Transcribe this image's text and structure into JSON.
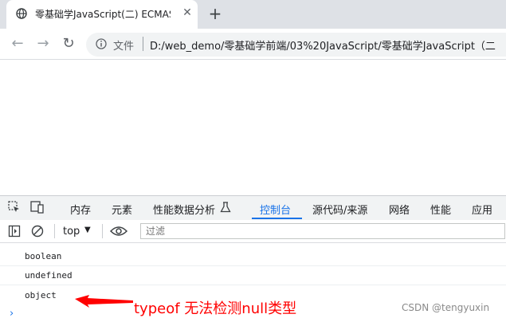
{
  "browser": {
    "tab_title": "零基础学JavaScript(二) ECMAS",
    "address_scheme_label": "文件",
    "url": "D:/web_demo/零基础学前端/03%20JavaScript/零基础学JavaScript（二"
  },
  "devtools": {
    "tabs": [
      "内存",
      "元素",
      "性能数据分析",
      "控制台",
      "源代码/来源",
      "网络",
      "性能",
      "应用"
    ],
    "active_tab": "控制台",
    "context": "top",
    "filter_placeholder": "过滤"
  },
  "console": {
    "rows": [
      "boolean",
      "undefined",
      "object"
    ],
    "prompt": "›"
  },
  "annotation": {
    "text": "typeof 无法检测null类型",
    "color": "#ff0000"
  },
  "watermark": "CSDN @tengyuxin",
  "colors": {
    "accent": "#1a73e8"
  }
}
